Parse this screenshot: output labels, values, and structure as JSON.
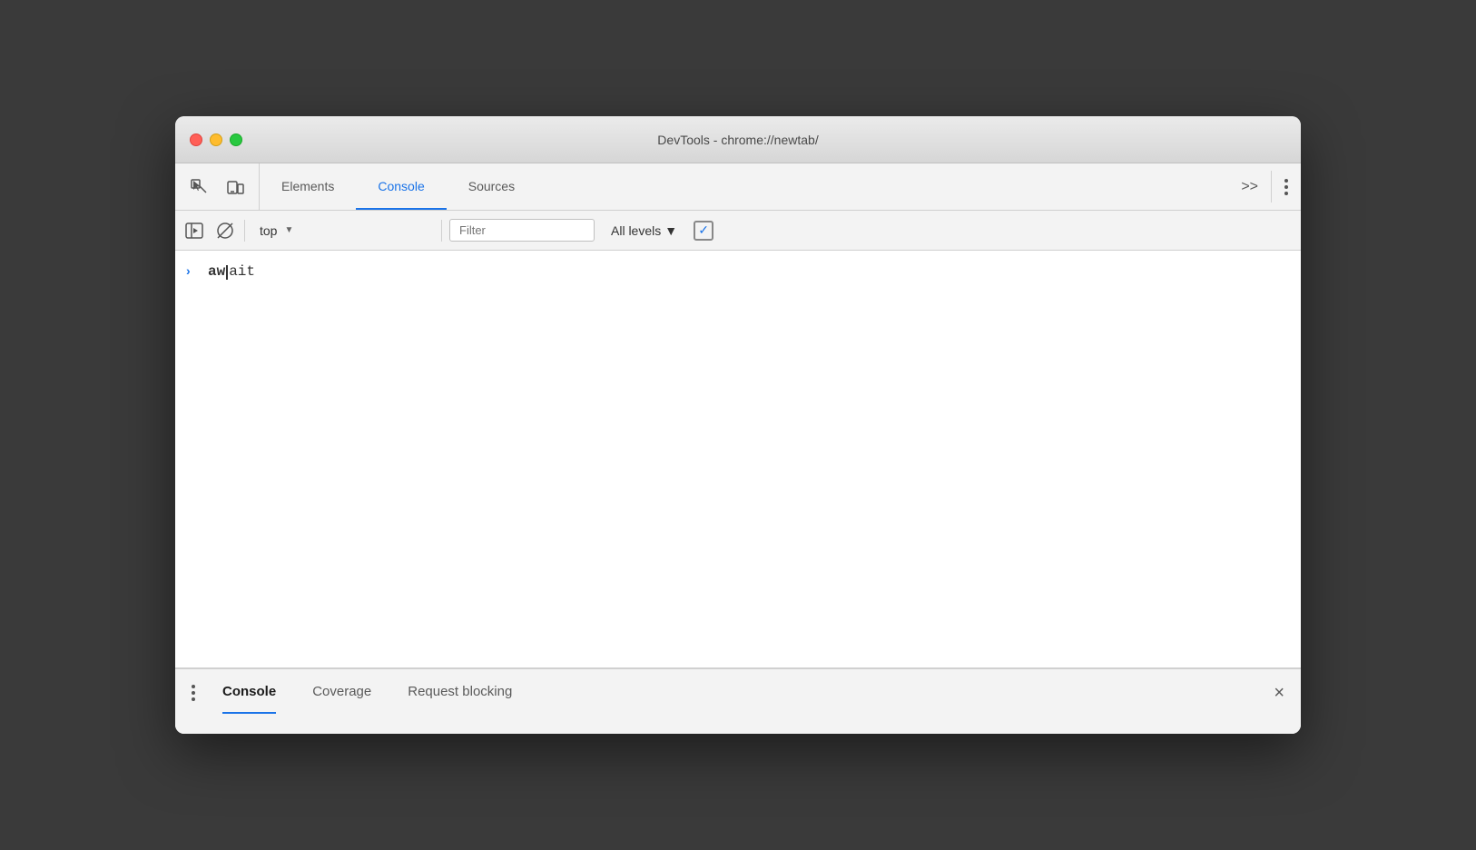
{
  "window": {
    "title": "DevTools - chrome://newtab/"
  },
  "traffic_lights": {
    "close_label": "close",
    "minimize_label": "minimize",
    "maximize_label": "maximize"
  },
  "toolbar": {
    "inspect_label": "inspect element",
    "device_label": "device toolbar",
    "tabs": [
      {
        "id": "elements",
        "label": "Elements",
        "active": false
      },
      {
        "id": "console",
        "label": "Console",
        "active": true
      },
      {
        "id": "sources",
        "label": "Sources",
        "active": false
      }
    ],
    "more_label": ">>",
    "menu_label": "⋮"
  },
  "console_toolbar": {
    "sidebar_label": "show console sidebar",
    "clear_label": "clear console",
    "context": {
      "value": "top",
      "arrow": "▼"
    },
    "filter": {
      "placeholder": "Filter",
      "value": ""
    },
    "levels": {
      "label": "All levels",
      "arrow": "▼"
    },
    "checkbox_checked": "✓"
  },
  "console_content": {
    "entries": [
      {
        "type": "input",
        "chevron": "›",
        "text_bold": "aw",
        "text_cursor": true,
        "text_mono": "ait"
      }
    ]
  },
  "bottom_drawer": {
    "tabs": [
      {
        "id": "console",
        "label": "Console",
        "active": true
      },
      {
        "id": "coverage",
        "label": "Coverage",
        "active": false
      },
      {
        "id": "request-blocking",
        "label": "Request blocking",
        "active": false
      }
    ],
    "close_label": "×"
  }
}
